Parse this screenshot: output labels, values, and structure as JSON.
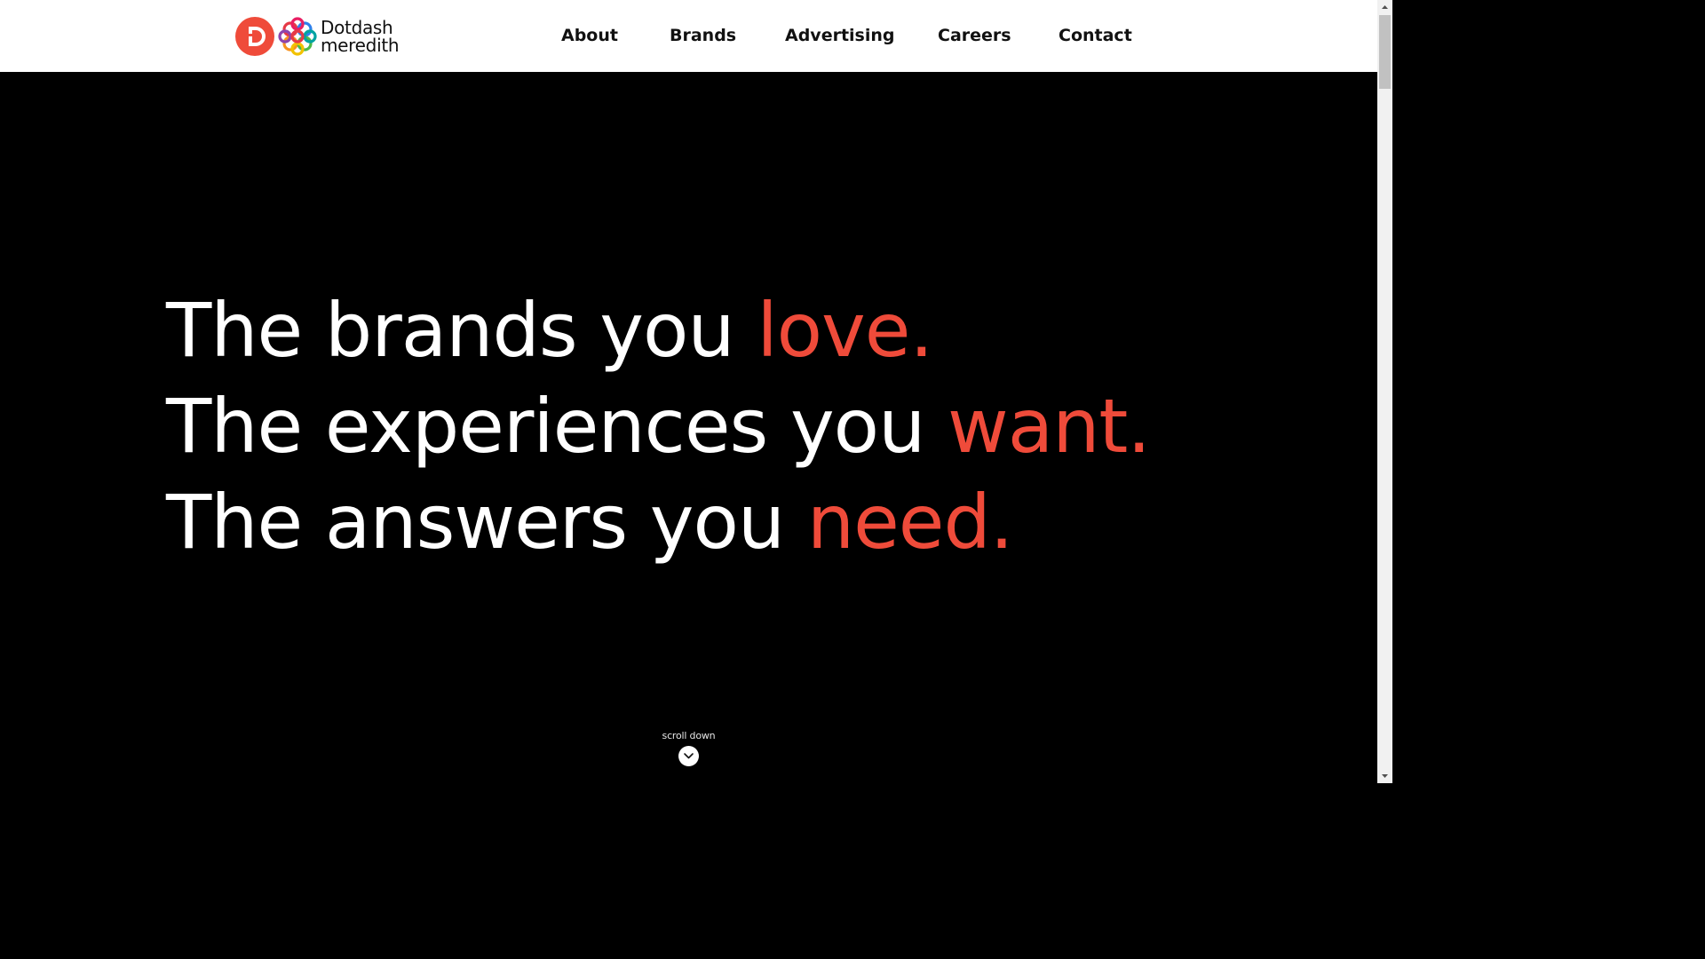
{
  "logo": {
    "line1": "Dotdash",
    "line2": "meredith",
    "colors": {
      "badge": "#ef4b3a",
      "knot": [
        "#e63946",
        "#f7931e",
        "#4cb848",
        "#2f80ed",
        "#8e44ad",
        "#e91e63"
      ]
    }
  },
  "nav": {
    "items": [
      {
        "label": "About"
      },
      {
        "label": "Brands"
      },
      {
        "label": "Advertising"
      },
      {
        "label": "Careers"
      },
      {
        "label": "Contact"
      }
    ]
  },
  "hero": {
    "lines": [
      {
        "text": "The brands you ",
        "accent": "love."
      },
      {
        "text": "The experiences you ",
        "accent": "want."
      },
      {
        "text": "The answers you ",
        "accent": "need."
      }
    ],
    "scroll_label": "scroll down",
    "scroll_icon": "chevron-down-icon"
  },
  "colors": {
    "background": "#000000",
    "header": "#ffffff",
    "text": "#ffffff",
    "accent": "#ef4b3a",
    "nav_text": "#111111"
  }
}
